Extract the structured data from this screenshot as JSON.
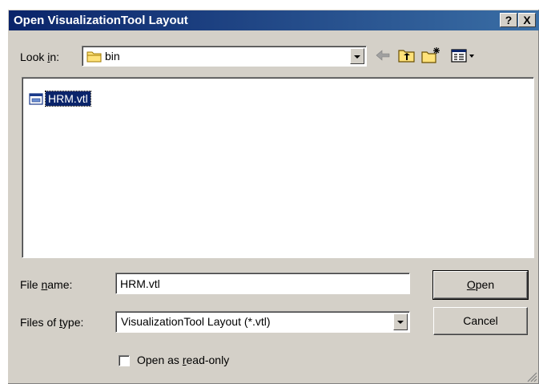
{
  "window": {
    "title": "Open VisualizationTool Layout",
    "help_label": "?",
    "close_label": "X"
  },
  "lookin": {
    "label_pre": "Look ",
    "label_access": "i",
    "label_post": "n:",
    "value": "bin",
    "icon": "folder-icon"
  },
  "toolbar": {
    "icons": [
      "back-arrow-icon",
      "up-folder-icon",
      "new-folder-icon",
      "view-menu-icon"
    ]
  },
  "files": [
    {
      "name": "HRM.vtl",
      "icon": "vtl-file-icon",
      "selected": true
    }
  ],
  "filename": {
    "label_pre": "File ",
    "label_access": "n",
    "label_post": "ame:",
    "value": "HRM.vtl"
  },
  "filetype": {
    "label_pre": "Files of ",
    "label_access": "t",
    "label_post": "ype:",
    "value": "VisualizationTool Layout (*.vtl)"
  },
  "buttons": {
    "open_access": "O",
    "open_rest": "pen",
    "cancel": "Cancel"
  },
  "readonly": {
    "label_pre": "Open as ",
    "label_access": "r",
    "label_post": "ead-only",
    "checked": false
  },
  "colors": {
    "face": "#d4d0c8",
    "title_start": "#0a246a",
    "title_end": "#3a6ea5",
    "selection": "#0a246a"
  }
}
